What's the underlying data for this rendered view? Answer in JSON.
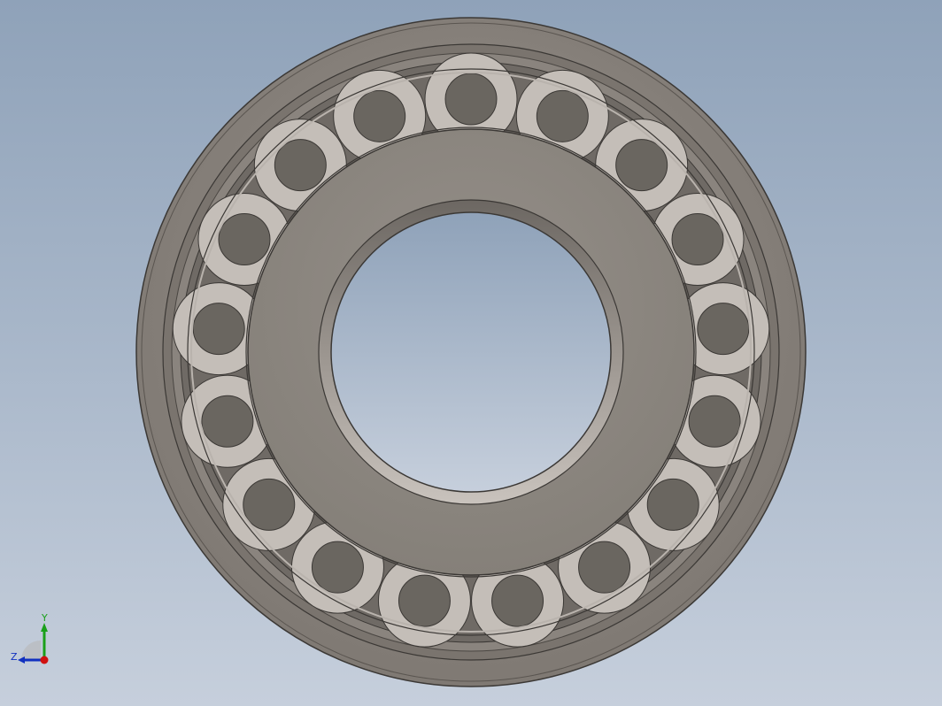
{
  "viewport": {
    "background_top": "#8fa2b9",
    "background_bottom": "#c6cfdc",
    "model": "cylindrical-roller-bearing",
    "roller_count": 17
  },
  "colors": {
    "ring": "#8c8680",
    "ring_shadow": "#6f6a65",
    "roller_end": "#6a6660",
    "cage": "#c4beb8",
    "edge": "#3b3835"
  },
  "triad": {
    "y_label": "Y",
    "z_label": "Z",
    "y_color": "#1aa01a",
    "x_color": "#d01010",
    "z_color": "#1030c0"
  }
}
